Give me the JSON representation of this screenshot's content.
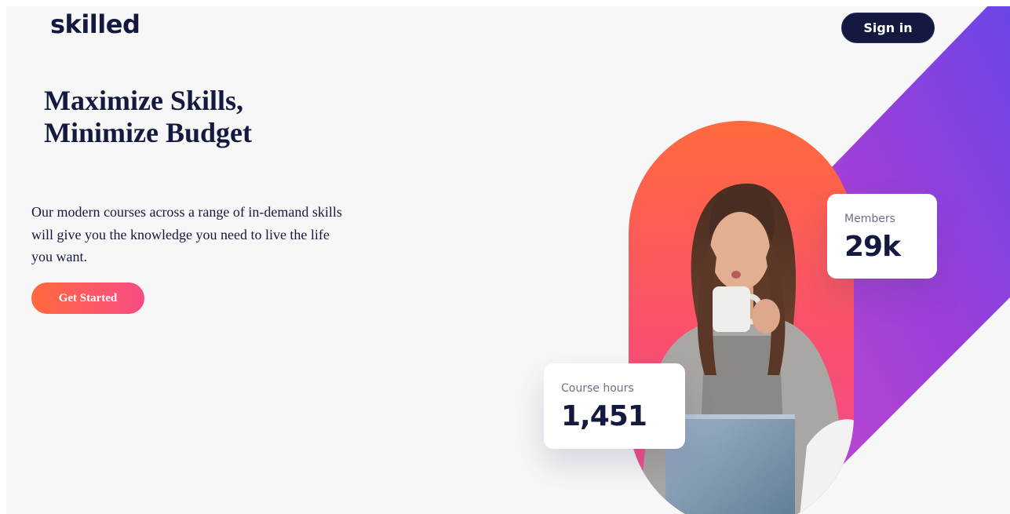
{
  "brand": {
    "logo_text": "skilled"
  },
  "header": {
    "signin_label": "Sign in"
  },
  "hero": {
    "headline_lines": [
      "Maximize Skills,",
      "Minimize Budget"
    ],
    "description": "Our modern courses across a range of in-demand skills will give you the knowledge you need to live the life you want.",
    "cta_label": "Get Started"
  },
  "stats": {
    "members": {
      "label": "Members",
      "value": "29k"
    },
    "course_hours": {
      "label": "Course hours",
      "value": "1,451"
    }
  },
  "colors": {
    "navy": "#14193f",
    "background": "#f7f7f7",
    "gradient_orange": "#ff6a3d",
    "gradient_pink": "#f74b85",
    "gradient_purple": "#6946e8"
  }
}
